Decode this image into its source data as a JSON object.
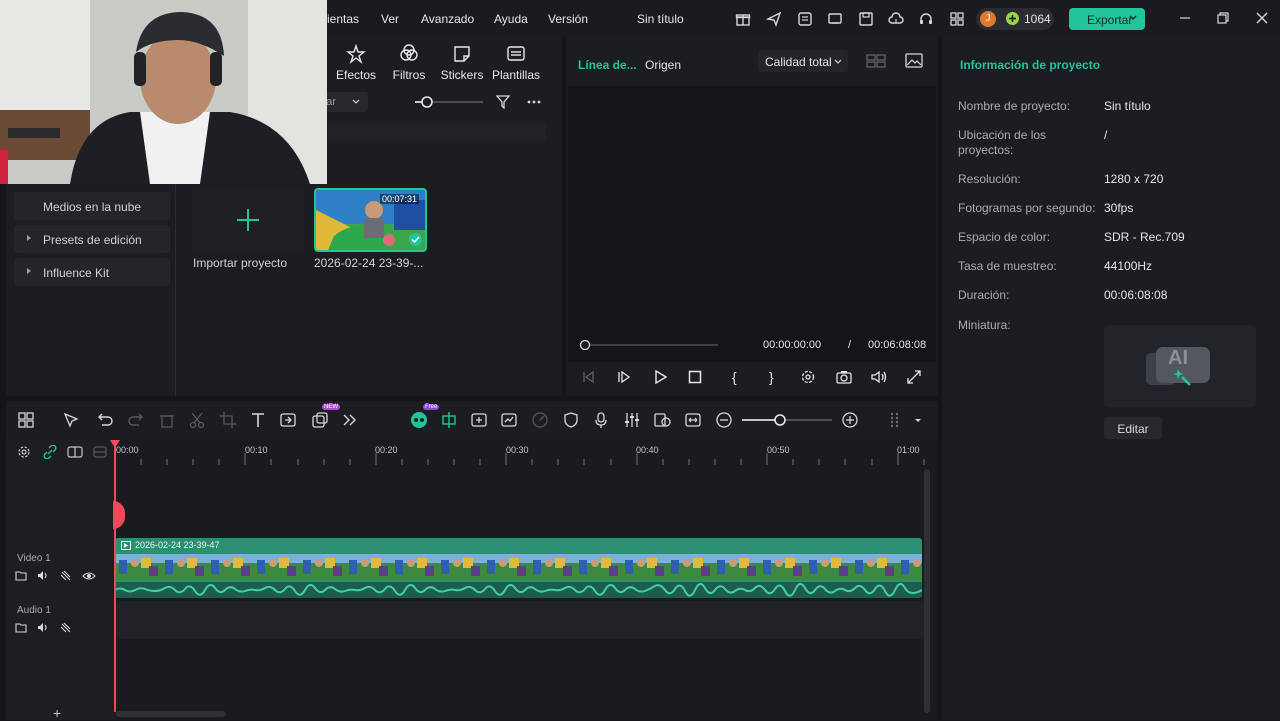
{
  "menu": {
    "herramientas_partial": "ientas",
    "ver": "Ver",
    "avanzado": "Avanzado",
    "ayuda": "Ayuda",
    "version": "Versión",
    "title": "Sin título"
  },
  "credits": {
    "avatar_letter": "J",
    "count": "1064"
  },
  "export": {
    "label": "Exportar"
  },
  "media_tabs": [
    {
      "label": "Efectos",
      "icon": "effects-icon"
    },
    {
      "label": "Filtros",
      "icon": "filters-icon"
    },
    {
      "label": "Stickers",
      "icon": "stickers-icon"
    },
    {
      "label": "Plantillas",
      "icon": "templates-icon"
    }
  ],
  "media_toolbar": {
    "sort_partial": "par"
  },
  "sidebar": {
    "items": [
      {
        "label": "Medios en la nube"
      },
      {
        "label": "Presets de edición"
      },
      {
        "label": "Influence Kit"
      }
    ]
  },
  "media_items": {
    "import_label": "Importar proyecto",
    "clip_name": "2026-02-24 23-39-...",
    "clip_duration": "00:07:31"
  },
  "preview": {
    "tab_timeline": "Línea de...",
    "tab_source": "Origen",
    "quality": "Calidad total",
    "current_time": "00:00:00:00",
    "separator": "/",
    "total_time": "00:06:08:08"
  },
  "info": {
    "title": "Información de proyecto",
    "rows": [
      {
        "label": "Nombre de proyecto:",
        "value": "Sin título"
      },
      {
        "label": "Ubicación de los proyectos:",
        "value": "/"
      },
      {
        "label": "Resolución:",
        "value": "1280 x 720"
      },
      {
        "label": "Fotogramas por segundo:",
        "value": "30fps"
      },
      {
        "label": "Espacio de color:",
        "value": "SDR - Rec.709"
      },
      {
        "label": "Tasa de muestreo:",
        "value": "44100Hz"
      },
      {
        "label": "Duración:",
        "value": "00:06:08:08"
      },
      {
        "label": "Miniatura:",
        "value": ""
      }
    ],
    "thumb_text": "AI",
    "edit_label": "Editar"
  },
  "timeline": {
    "ai_badge": "Free",
    "new_badge": "NEW",
    "ruler_labels": [
      "00:00",
      "00:10",
      "00:20",
      "00:30",
      "00:40",
      "00:50",
      "01:00"
    ],
    "video_track": "Video 1",
    "audio_track": "Audio 1",
    "clip_label": "2026-02-24 23-39-47"
  },
  "colors": {
    "accent": "#22c59b",
    "playhead": "#ee4a5a",
    "clip": "#2b8f72"
  }
}
